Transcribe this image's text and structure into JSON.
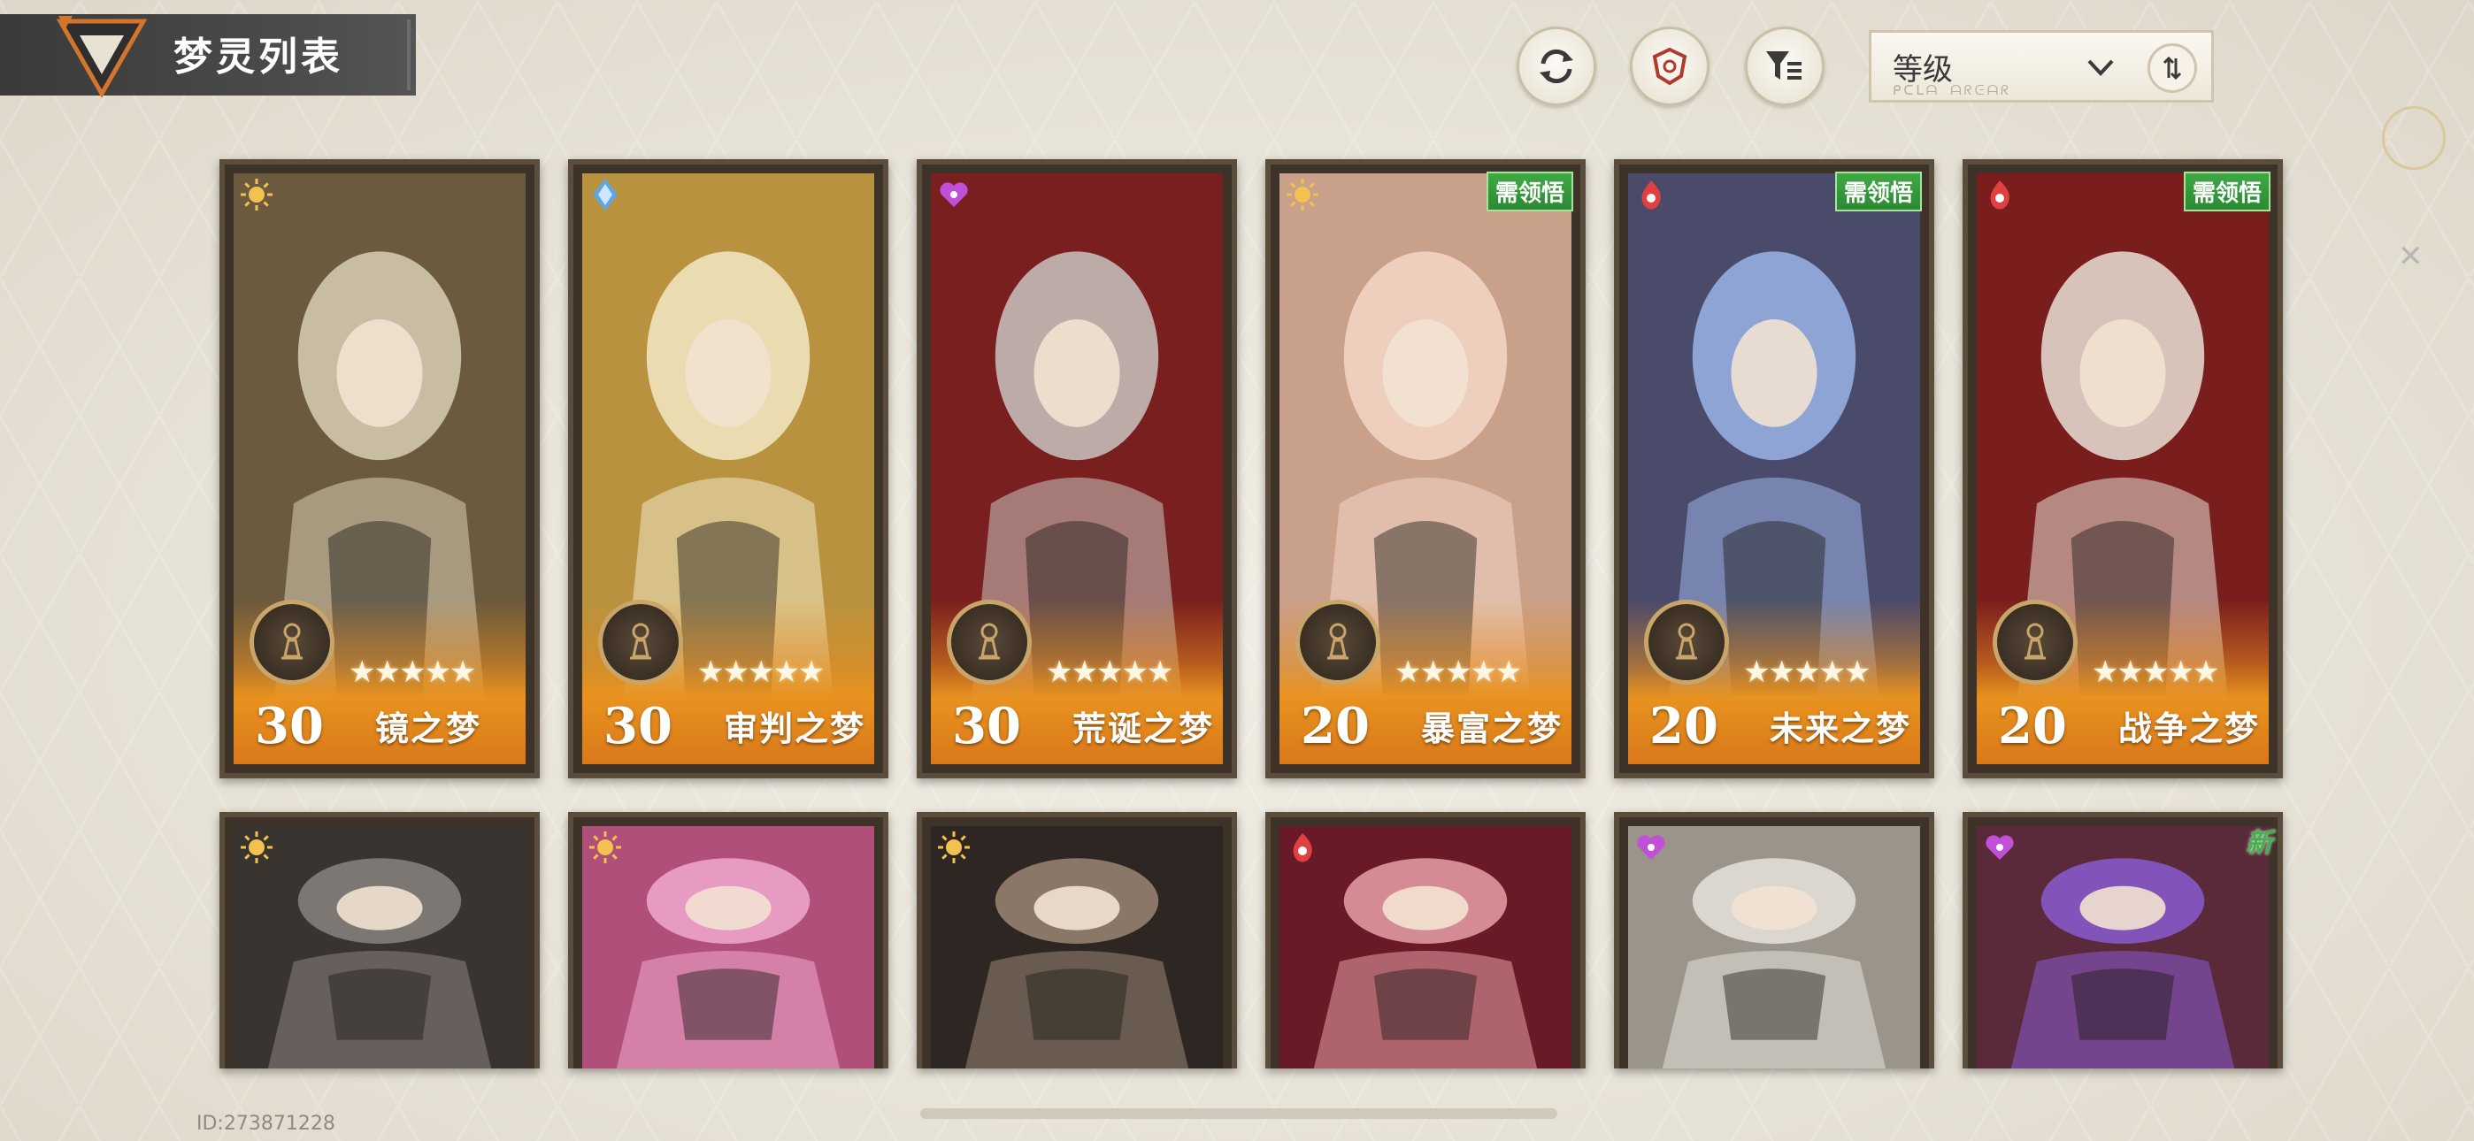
{
  "header": {
    "title": "梦灵列表",
    "buttons": [
      {
        "icon": "refresh-icon"
      },
      {
        "icon": "target-shield-icon"
      },
      {
        "icon": "filter-icon"
      }
    ],
    "sort": {
      "selected": "等级",
      "subtitle": "ᑭᑕᒪᗩ ᗩᖇᕮᗩᖇ",
      "direction_icon": "sort-direction-icon"
    }
  },
  "cards_row1": [
    {
      "level": "30",
      "name": "镜之梦",
      "element_icon": "sun-element-icon",
      "element_color": "#f2c14e",
      "art_colors": [
        "#6b5a3e",
        "#d8cfb5"
      ],
      "need_badge": ""
    },
    {
      "level": "30",
      "name": "审判之梦",
      "element_icon": "crystal-element-icon",
      "element_color": "#5da7e6",
      "art_colors": [
        "#b8923e",
        "#f3e7c4"
      ],
      "need_badge": ""
    },
    {
      "level": "30",
      "name": "荒诞之梦",
      "element_icon": "heart-element-icon",
      "element_color": "#c24fd8",
      "art_colors": [
        "#7a1f1f",
        "#c9c4c0"
      ],
      "need_badge": ""
    },
    {
      "level": "20",
      "name": "暴富之梦",
      "element_icon": "sun-element-icon",
      "element_color": "#f2c14e",
      "art_colors": [
        "#c9a08a",
        "#f4d6c6"
      ],
      "need_badge": "需领悟"
    },
    {
      "level": "20",
      "name": "未来之梦",
      "element_icon": "flame-element-icon",
      "element_color": "#e04040",
      "art_colors": [
        "#4a4a6a",
        "#9ab4e8"
      ],
      "need_badge": "需领悟"
    },
    {
      "level": "20",
      "name": "战争之梦",
      "element_icon": "flame-element-icon",
      "element_color": "#e04040",
      "art_colors": [
        "#7a1d1d",
        "#e8e0d6"
      ],
      "need_badge": "需领悟"
    }
  ],
  "cards_row2": [
    {
      "element_icon": "sun-element-icon",
      "element_color": "#f2c14e",
      "art_colors": [
        "#3a3430",
        "#8a8480"
      ],
      "badge": ""
    },
    {
      "element_icon": "sun-element-icon",
      "element_color": "#f2c14e",
      "art_colors": [
        "#b0507a",
        "#f2a8cf"
      ],
      "badge": ""
    },
    {
      "element_icon": "sun-element-icon",
      "element_color": "#f2c14e",
      "art_colors": [
        "#2e2622",
        "#9a8674"
      ],
      "badge": ""
    },
    {
      "element_icon": "flame-element-icon",
      "element_color": "#e04040",
      "art_colors": [
        "#6a1a26",
        "#e8a0a8"
      ],
      "badge": ""
    },
    {
      "element_icon": "heart-element-icon",
      "element_color": "#c24fd8",
      "art_colors": [
        "#9a948a",
        "#e6e2da"
      ],
      "badge": ""
    },
    {
      "element_icon": "heart-element-icon",
      "element_color": "#c24fd8",
      "art_colors": [
        "#5a2a3a",
        "#8a5ad0"
      ],
      "badge": "新"
    }
  ],
  "star_text": "★★★★★",
  "footer": {
    "uid": "ID:273871228"
  }
}
